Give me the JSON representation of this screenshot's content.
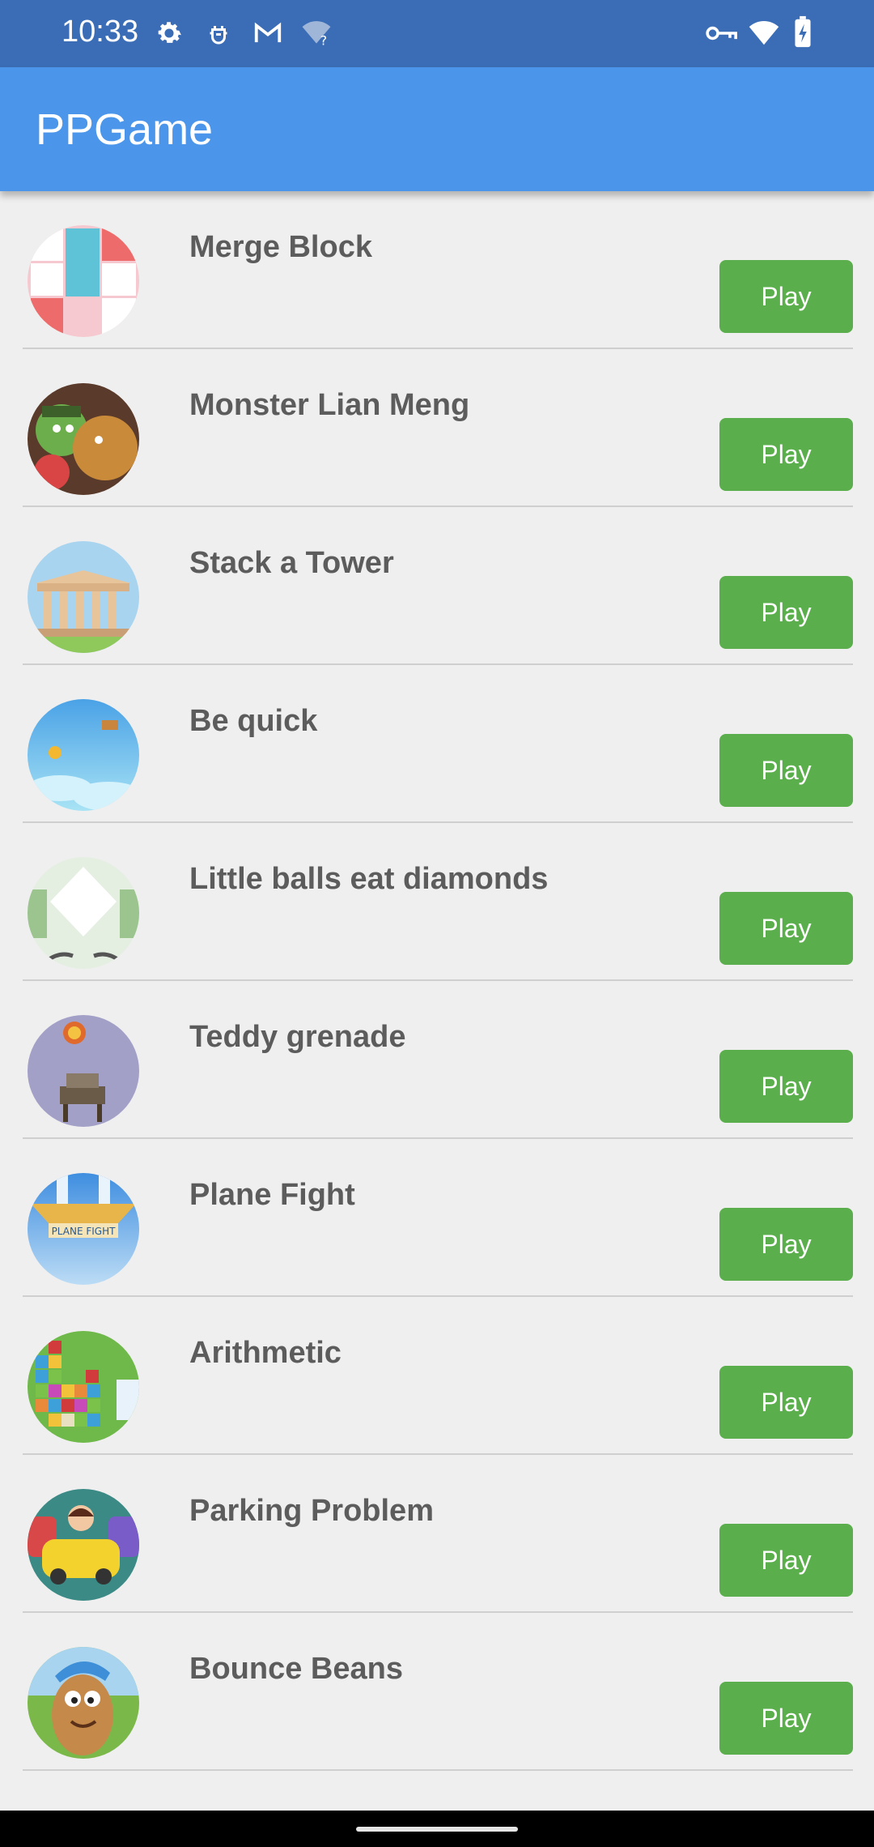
{
  "status_bar": {
    "time": "10:33",
    "left_icons": [
      "settings-icon",
      "android-debug-icon",
      "gmail-icon",
      "wifi-question-icon"
    ],
    "right_icons": [
      "vpn-key-icon",
      "wifi-icon",
      "battery-charging-icon"
    ]
  },
  "app_bar": {
    "title": "PPGame",
    "color": "#4b96ea"
  },
  "games": [
    {
      "title": "Merge Block",
      "button": "Play"
    },
    {
      "title": "Monster Lian Meng",
      "button": "Play"
    },
    {
      "title": "Stack a Tower",
      "button": "Play"
    },
    {
      "title": "Be quick",
      "button": "Play"
    },
    {
      "title": "Little balls eat diamonds",
      "button": "Play"
    },
    {
      "title": "Teddy grenade",
      "button": "Play"
    },
    {
      "title": "Plane Fight",
      "button": "Play"
    },
    {
      "title": "Arithmetic",
      "button": "Play"
    },
    {
      "title": "Parking Problem",
      "button": "Play"
    },
    {
      "title": "Bounce Beans",
      "button": "Play"
    }
  ],
  "thumb_texts": {
    "plane_fight": "PLANE FIGHT"
  },
  "colors": {
    "status_bar": "#3b6db6",
    "play_button": "#5bae4c",
    "background": "#efefef",
    "title_text": "#5c5c5c"
  }
}
